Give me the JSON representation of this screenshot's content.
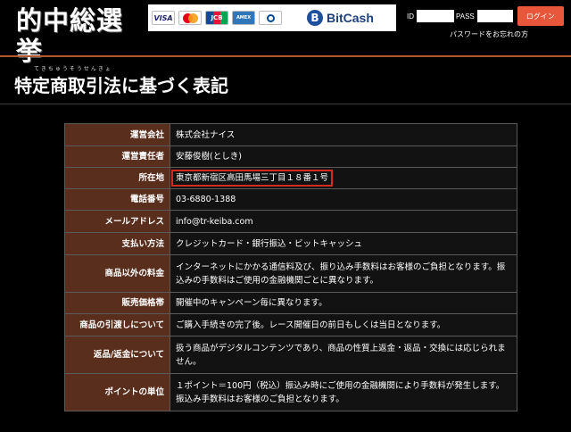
{
  "header": {
    "logo_text": "的中総選挙",
    "logo_sub": "てきちゅうそうせんきょ",
    "payment": {
      "cards": [
        {
          "name": "visa-logo",
          "label": "VISA"
        },
        {
          "name": "mastercard-logo",
          "label": "MasterCard"
        },
        {
          "name": "jcb-logo",
          "label": "JCB"
        },
        {
          "name": "amex-logo",
          "label": "AMERICAN EXPRESS"
        },
        {
          "name": "diners-logo",
          "label": "Diners Club International"
        }
      ],
      "bitcash_icon": "B",
      "bitcash_label": "BitCash"
    },
    "login": {
      "id_label": "ID",
      "pass_label": "PASS",
      "button_label": "ログイン",
      "forgot_label": "パスワードをお忘れの方"
    }
  },
  "page_title": "特定商取引法に基づく表記",
  "table": {
    "rows": [
      {
        "label": "運営会社",
        "value": "株式会社ナイス"
      },
      {
        "label": "運営責任者",
        "value": "安藤俊樹(としき)"
      },
      {
        "label": "所在地",
        "value": "東京都新宿区高田馬場三丁目１８番１号",
        "highlight": true
      },
      {
        "label": "電話番号",
        "value": "03-6880-1388"
      },
      {
        "label": "メールアドレス",
        "value": "info@tr-keiba.com"
      },
      {
        "label": "支払い方法",
        "value": "クレジットカード・銀行振込・ビットキャッシュ"
      },
      {
        "label": "商品以外の料金",
        "value": "インターネットにかかる通信料及び、振り込み手数料はお客様のご負担となります。振込みの手数料はご使用の金融機関ごとに異なります。"
      },
      {
        "label": "販売価格帯",
        "value": "開催中のキャンペーン毎に異なります。"
      },
      {
        "label": "商品の引渡しについて",
        "value": "ご購入手続きの完了後。レース開催日の前日もしくは当日となります。"
      },
      {
        "label": "返品/返金について",
        "value": "扱う商品がデジタルコンテンツであり、商品の性質上返金・返品・交換には応じられません。"
      },
      {
        "label": "ポイントの単位",
        "value": "１ポイント＝100円（税込）振込み時にご使用の金融機関により手数料が発生します。振込み手数料はお客様のご負担となります。"
      }
    ]
  },
  "colors": {
    "accent": "#b4572e",
    "label_bg": "#5a2e1c",
    "login_button": "#e8573b",
    "highlight_border": "#d62a20"
  }
}
